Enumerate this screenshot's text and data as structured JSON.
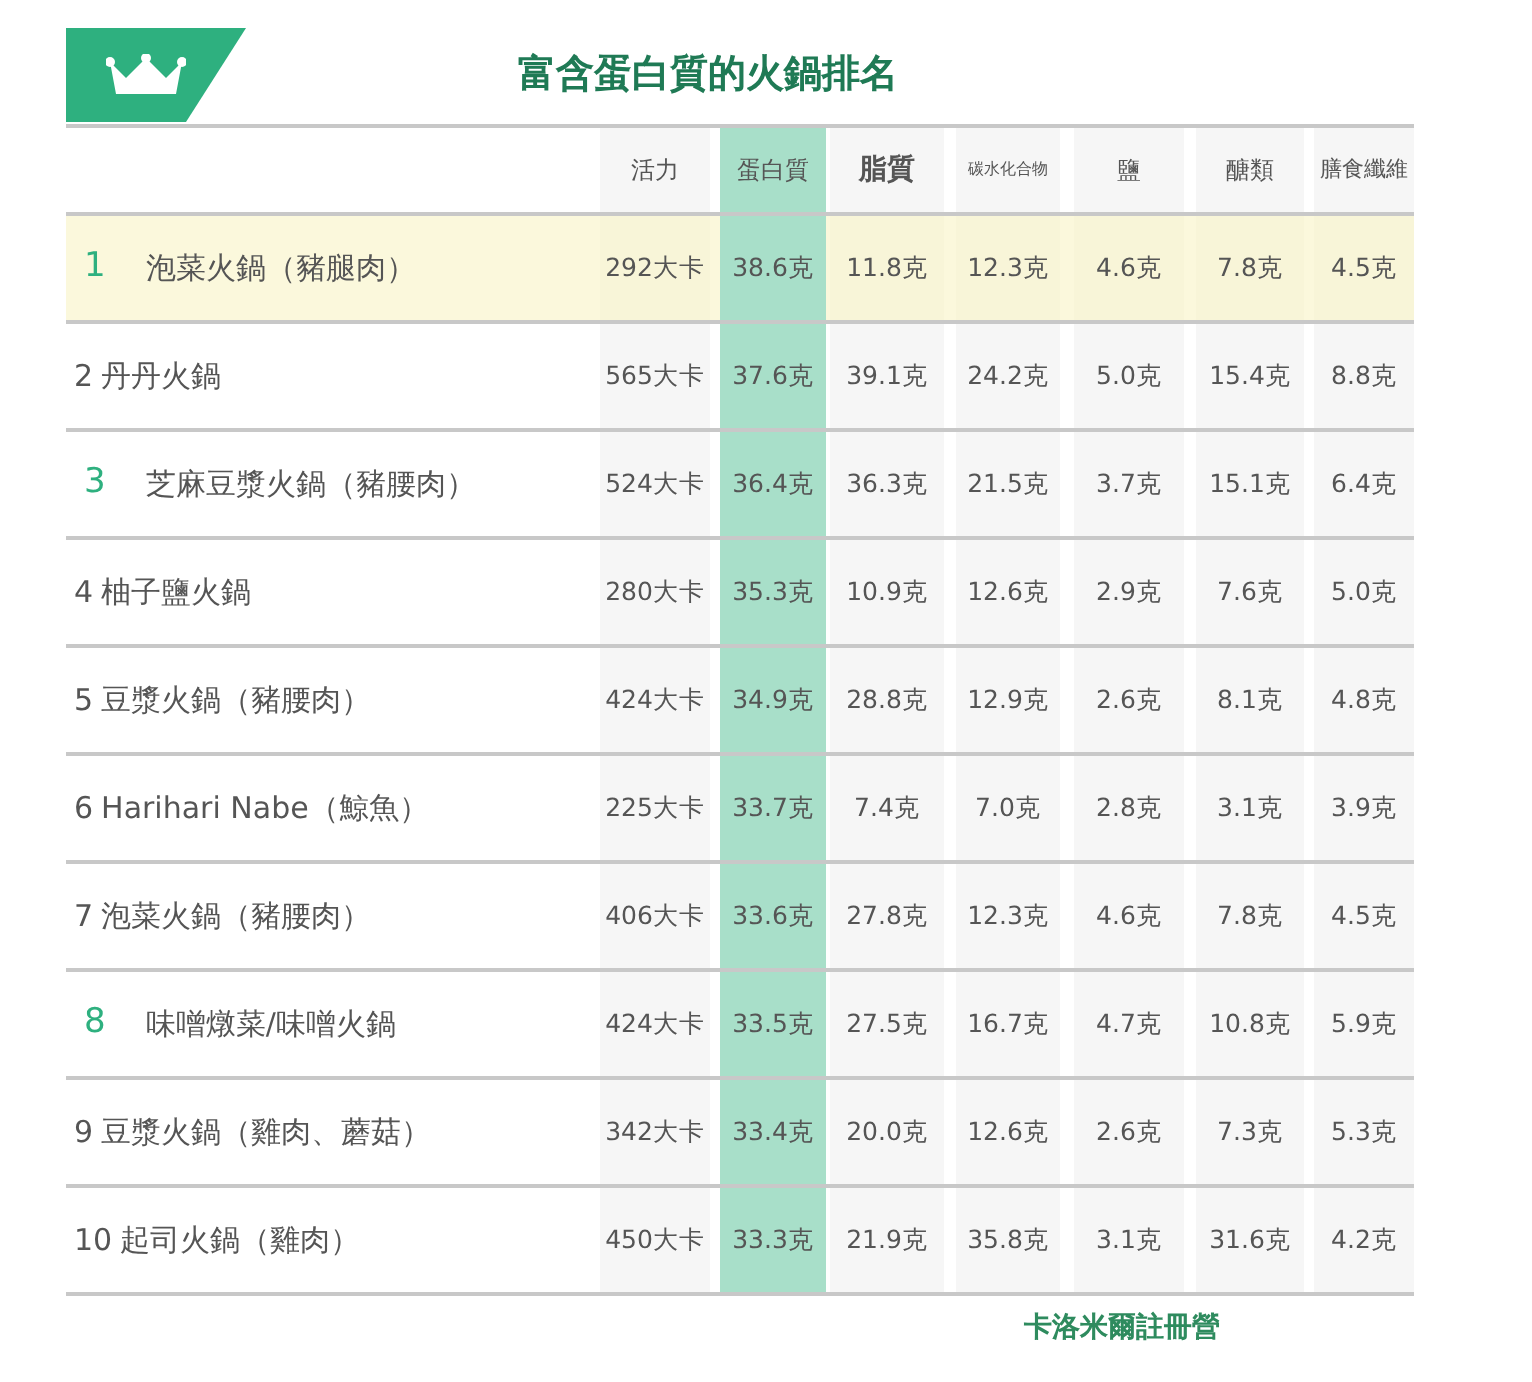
{
  "title": "富含蛋白質的火鍋排名",
  "columns": [
    "活力",
    "蛋白質",
    "脂質",
    "碳水化合物",
    "鹽",
    "醣類",
    "膳食纖維"
  ],
  "rows": [
    {
      "rank": "1",
      "name": "泡菜火鍋（豬腿肉）",
      "accent": true,
      "highlighted": true,
      "values": [
        "292大卡",
        "38.6克",
        "11.8克",
        "12.3克",
        "4.6克",
        "7.8克",
        "4.5克"
      ]
    },
    {
      "rank": "2",
      "name": "丹丹火鍋",
      "accent": false,
      "highlighted": false,
      "values": [
        "565大卡",
        "37.6克",
        "39.1克",
        "24.2克",
        "5.0克",
        "15.4克",
        "8.8克"
      ]
    },
    {
      "rank": "3",
      "name": "芝麻豆漿火鍋（豬腰肉）",
      "accent": true,
      "highlighted": false,
      "values": [
        "524大卡",
        "36.4克",
        "36.3克",
        "21.5克",
        "3.7克",
        "15.1克",
        "6.4克"
      ]
    },
    {
      "rank": "4",
      "name": "柚子鹽火鍋",
      "accent": false,
      "highlighted": false,
      "values": [
        "280大卡",
        "35.3克",
        "10.9克",
        "12.6克",
        "2.9克",
        "7.6克",
        "5.0克"
      ]
    },
    {
      "rank": "5",
      "name": "豆漿火鍋（豬腰肉）",
      "accent": false,
      "highlighted": false,
      "values": [
        "424大卡",
        "34.9克",
        "28.8克",
        "12.9克",
        "2.6克",
        "8.1克",
        "4.8克"
      ]
    },
    {
      "rank": "6",
      "name": "Harihari Nabe（鯨魚）",
      "accent": false,
      "highlighted": false,
      "values": [
        "225大卡",
        "33.7克",
        "7.4克",
        "7.0克",
        "2.8克",
        "3.1克",
        "3.9克"
      ]
    },
    {
      "rank": "7",
      "name": "泡菜火鍋（豬腰肉）",
      "accent": false,
      "highlighted": false,
      "values": [
        "406大卡",
        "33.6克",
        "27.8克",
        "12.3克",
        "4.6克",
        "7.8克",
        "4.5克"
      ]
    },
    {
      "rank": "8",
      "name": "味噌燉菜/味噌火鍋",
      "accent": true,
      "highlighted": false,
      "values": [
        "424大卡",
        "33.5克",
        "27.5克",
        "16.7克",
        "4.7克",
        "10.8克",
        "5.9克"
      ]
    },
    {
      "rank": "9",
      "name": "豆漿火鍋（雞肉、蘑菇）",
      "accent": false,
      "highlighted": false,
      "values": [
        "342大卡",
        "33.4克",
        "20.0克",
        "12.6克",
        "2.6克",
        "7.3克",
        "5.3克"
      ]
    },
    {
      "rank": "10",
      "name": "起司火鍋（雞肉）",
      "accent": false,
      "highlighted": false,
      "values": [
        "450大卡",
        "33.3克",
        "21.9克",
        "35.8克",
        "3.1克",
        "31.6克",
        "4.2克"
      ]
    }
  ],
  "footer": "卡洛米爾註冊營"
}
